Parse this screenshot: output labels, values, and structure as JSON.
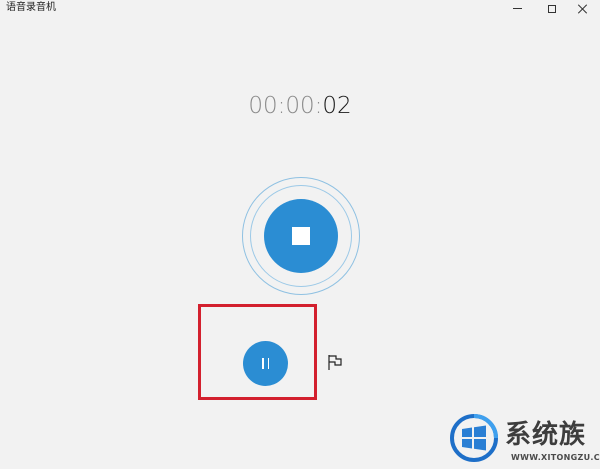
{
  "window": {
    "title": "语音录音机",
    "controls": {
      "minimize": "minimize",
      "maximize": "maximize",
      "close": "close"
    }
  },
  "timer": {
    "hours": "00",
    "sep1": ":",
    "minutes": "00",
    "sep2": ":",
    "seconds": "02"
  },
  "controls": {
    "stop_icon": "stop-icon",
    "pause_icon": "pause-icon",
    "flag_icon": "flag-icon"
  },
  "watermark": {
    "brand": "系统族",
    "url": "WWW.XITONGZU.COM"
  },
  "colors": {
    "background": "#f2f2f2",
    "accent": "#2b8dd3",
    "ring": "#8fc1e2",
    "highlight": "#d3202e",
    "timer_dim": "#8a8a8a",
    "timer_bright": "#1a1a1a"
  }
}
